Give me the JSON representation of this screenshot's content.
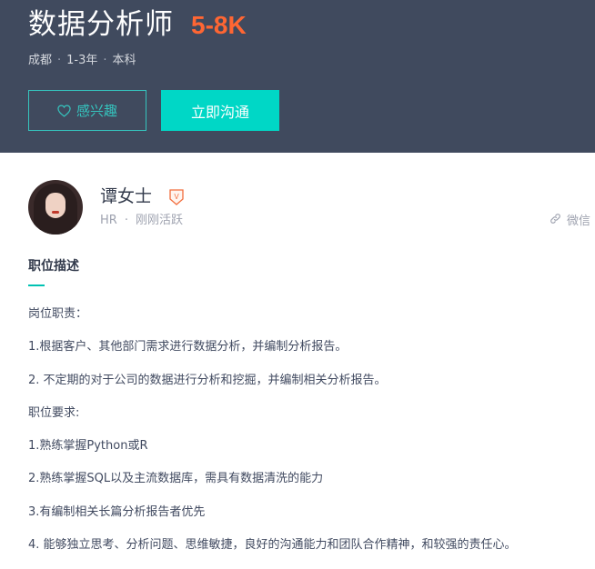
{
  "job": {
    "title": "数据分析师",
    "salary": "5-8K",
    "city": "成都",
    "experience": "1-3年",
    "education": "本科",
    "separator": "·"
  },
  "actions": {
    "interest_label": "感兴趣",
    "chat_label": "立即沟通"
  },
  "recruiter": {
    "name": "谭女士",
    "badge": "V",
    "role": "HR",
    "separator": "·",
    "status": "刚刚活跃",
    "share_label": "微信"
  },
  "description": {
    "title": "职位描述",
    "lines": [
      "岗位职责：",
      "1.根据客户、其他部门需求进行数据分析，并编制分析报告。",
      "2. 不定期的对于公司的数据进行分析和挖掘，并编制相关分析报告。",
      "职位要求:",
      "1.熟练掌握Python或R",
      "2.熟练掌握SQL以及主流数据库，需具有数据清洗的能力",
      "3.有编制相关长篇分析报告者优先",
      "4. 能够独立思考、分析问题、思维敏捷，良好的沟通能力和团队合作精神，和较强的责任心。"
    ]
  },
  "icons": {
    "interest": "heart-outline-icon",
    "verify": "verified-badge-icon",
    "share": "link-icon"
  },
  "colors": {
    "header_bg": "#404a5e",
    "salary": "#ff6633",
    "accent": "#00d7c6",
    "outline_accent": "#35c4be",
    "badge": "#f26d3d"
  }
}
